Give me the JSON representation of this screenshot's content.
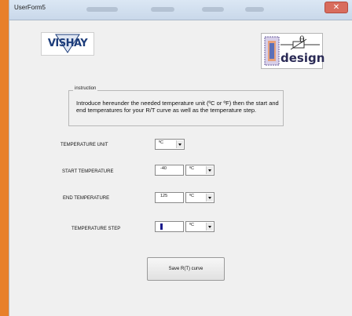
{
  "window": {
    "title": "UserForm5",
    "close_glyph": "✕"
  },
  "logos": {
    "vishay": "VISHAY",
    "design": "design",
    "design_symbol": "θ"
  },
  "instruction": {
    "legend": "instruction",
    "text": "Introduce hereunder  the needed temperature unit (ºC or ºF) then the start and end temperatures  for your R/T curve as well as the temperature step."
  },
  "form": {
    "temperature_unit": {
      "label": "TEMPERATURE UNIT",
      "unit": "ºC"
    },
    "start_temperature": {
      "label": "START TEMPERATURE",
      "value": "-40",
      "unit": "ºC"
    },
    "end_temperature": {
      "label": "END TEMPERATURE",
      "value": "125",
      "unit": "ºC"
    },
    "temperature_step": {
      "label": "TEMPERATURE STEP",
      "value": "",
      "unit": "ºC"
    }
  },
  "buttons": {
    "save": "Save R(T) curve"
  },
  "colors": {
    "background_orange": "#e8802a",
    "vishay_blue": "#1c3c7a",
    "form_bg": "#f0f0f0"
  }
}
